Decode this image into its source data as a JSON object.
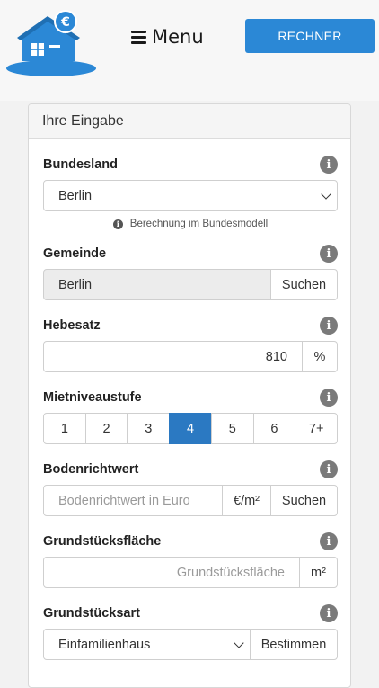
{
  "header": {
    "menu_label": "Menu",
    "calc_button": "RECHNER",
    "accent_color": "#2b88d6"
  },
  "card": {
    "title": "Ihre Eingabe",
    "bundesland": {
      "label": "Bundesland",
      "value": "Berlin",
      "note": "Berechnung im Bundesmodell"
    },
    "gemeinde": {
      "label": "Gemeinde",
      "value": "Berlin",
      "button": "Suchen"
    },
    "hebesatz": {
      "label": "Hebesatz",
      "value": "810",
      "unit": "%"
    },
    "mietniveau": {
      "label": "Mietniveaustufe",
      "options": [
        "1",
        "2",
        "3",
        "4",
        "5",
        "6",
        "7+"
      ],
      "selected": "4"
    },
    "bodenrichtwert": {
      "label": "Bodenrichtwert",
      "placeholder": "Bodenrichtwert in Euro",
      "unit": "€/m²",
      "button": "Suchen"
    },
    "flaeche": {
      "label": "Grundstücksfläche",
      "placeholder": "Grundstücksfläche",
      "unit": "m²"
    },
    "art": {
      "label": "Grundstücksart",
      "value": "Einfamilienhaus",
      "button": "Bestimmen"
    }
  }
}
